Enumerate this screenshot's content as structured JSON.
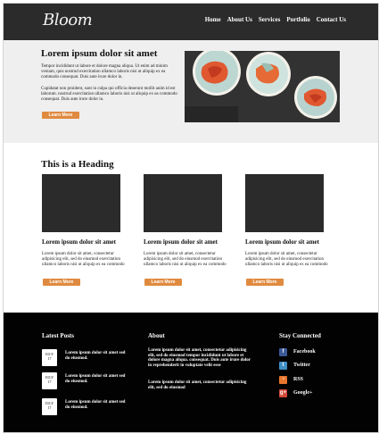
{
  "header": {
    "logo": "Bloom",
    "nav": [
      "Home",
      "About Us",
      "Services",
      "Portfolio",
      "Contact Us"
    ]
  },
  "hero": {
    "title": "Lorem ipsum dolor sit amet",
    "paragraph1": "Tempor incididunt ut labore et dolore magna aliqua. Ut enim ad minim veniam, quis nostrud exercitation ullamco laboris nisi ut aliquip ex ea commodo consequat. Duis aute irure dolor in.",
    "paragraph2": "Cupidatat non proident, sunt in culpa qui officia deserunt mollit anim id est laborum. nostrud exercitation ullamco laboris nisi ut aliquip ex ea commodo consequat. Duis aute irure dolor in.",
    "button": "Learn More"
  },
  "section": {
    "heading": "This is a Heading",
    "columns": [
      {
        "title": "Lorem ipsum dolor sit amet",
        "text": "Lorem ipsum dolor sit amet, consectetur adipisicing elit, sed do eiusmod exercitation ullamco laboris nisi ut aliquip ex ea commodo",
        "button": "Learn More"
      },
      {
        "title": "Lorem ipsum dolor sit amet",
        "text": "Lorem ipsum dolor sit amet, consectetur adipisicing elit, sed do eiusmod exercitation ullamco laboris nisi ut aliquip ex ea commodo",
        "button": "Learn More"
      },
      {
        "title": "Lorem ipsum dolor sit amet",
        "text": "Lorem ipsum dolor sit amet, consectetur adipisicing elit, sed do eiusmod exercitation ullamco laboris nisi ut aliquip ex ea commodo",
        "button": "Learn More"
      }
    ]
  },
  "footer": {
    "latest_posts": {
      "heading": "Latest Posts",
      "posts": [
        {
          "date_month": "JULY",
          "date_day": "17",
          "text": "Lorem ipsum dolor sit amet sed do eiusmod."
        },
        {
          "date_month": "JULY",
          "date_day": "17",
          "text": "Lorem ipsum dolor sit amet sed do eiusmod."
        },
        {
          "date_month": "JULY",
          "date_day": "17",
          "text": "Lorem ipsum dolor sit amet sed do eiusmod."
        }
      ]
    },
    "about": {
      "heading": "About",
      "paragraph1": "Lorem ipsum dolor sit amet, consectetur adipisicing elit, sed do eiusmod tempor incididunt ut labore et dolore magna aliqua. consequat. Duis aute irure dolor in reprehenderit in voluptate velit esse",
      "paragraph2": "Lorem ipsum dolor sit amet, consectetur adipisicing elit, sed do eiusmod"
    },
    "stay_connected": {
      "heading": "Stay Connected",
      "links": [
        {
          "label": "Facebook",
          "icon": "facebook-icon",
          "glyph": "f",
          "color": "#3b5998"
        },
        {
          "label": "Twitter",
          "icon": "twitter-icon",
          "glyph": "t",
          "color": "#3f8fc4"
        },
        {
          "label": "RSS",
          "icon": "rss-icon",
          "glyph": "◔",
          "color": "#e8772e"
        },
        {
          "label": "Google+",
          "icon": "google-plus-icon",
          "glyph": "g+",
          "color": "#d34836"
        }
      ]
    }
  },
  "colors": {
    "header_bg": "#2b2b2b",
    "hero_bg": "#efefef",
    "accent_button": "#e08a3f",
    "footer_bg": "#020202"
  }
}
